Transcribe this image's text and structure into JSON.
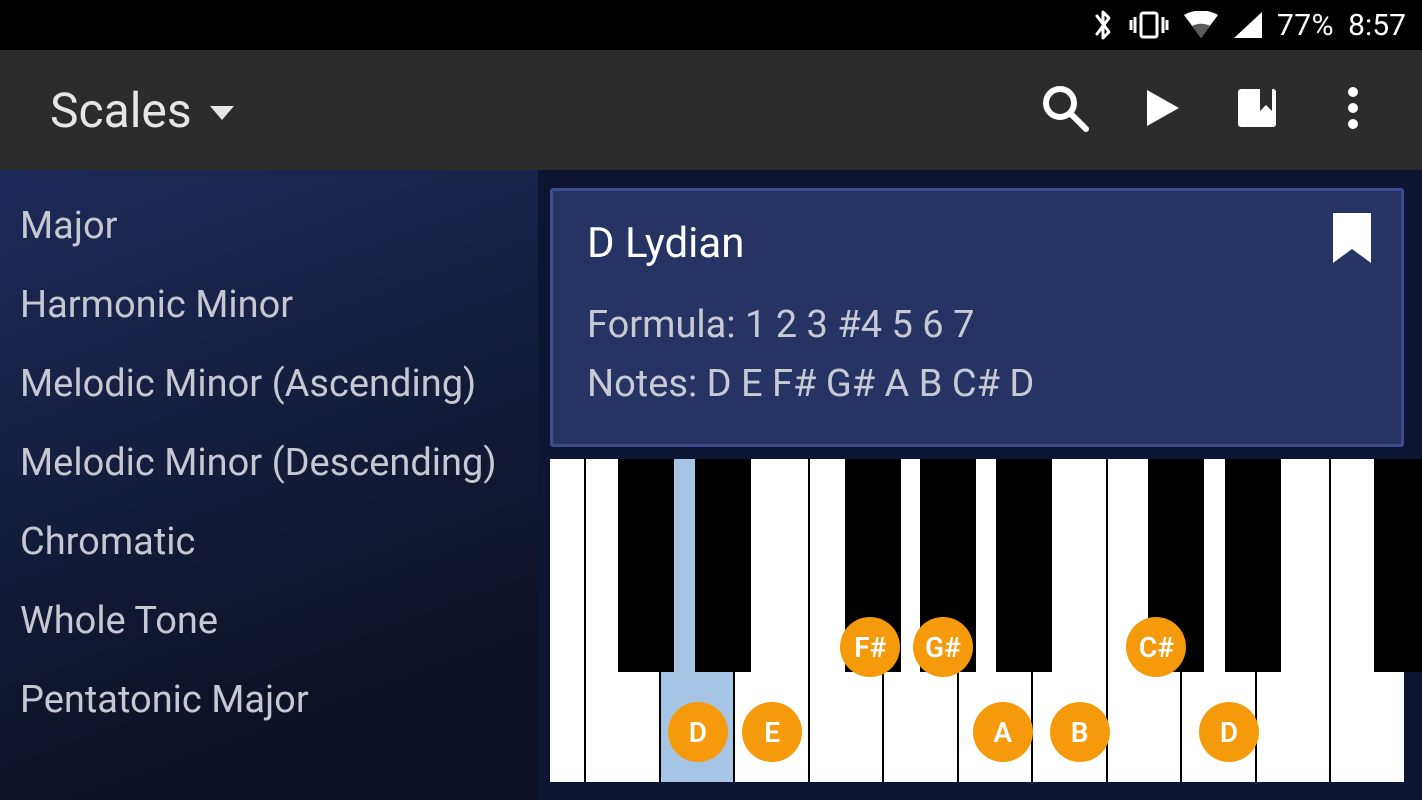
{
  "status": {
    "battery_pct": "77%",
    "time": "8:57",
    "icons": [
      "bluetooth",
      "vibrate",
      "wifi",
      "signal"
    ]
  },
  "appbar": {
    "title": "Scales",
    "actions": {
      "search": "search",
      "play": "play",
      "bookmark": "bookmark",
      "overflow": "more"
    }
  },
  "sidebar": {
    "items": [
      {
        "label": "Major"
      },
      {
        "label": "Harmonic Minor"
      },
      {
        "label": "Melodic Minor (Ascending)"
      },
      {
        "label": "Melodic Minor (Descending)"
      },
      {
        "label": "Chromatic"
      },
      {
        "label": "Whole Tone"
      },
      {
        "label": "Pentatonic Major"
      }
    ]
  },
  "detail": {
    "name": "D Lydian",
    "formula_label": "Formula: 1 2 3 #4 5 6 7",
    "notes_label": "Notes: D E F# G# A B C# D"
  },
  "piano": {
    "highlighted_white_index": 2,
    "markers": [
      {
        "note": "D",
        "type": "white",
        "left_pct": 13.8
      },
      {
        "note": "E",
        "type": "white",
        "left_pct": 22.5
      },
      {
        "note": "F#",
        "type": "black",
        "left_pct": 34.0
      },
      {
        "note": "G#",
        "type": "black",
        "left_pct": 42.5
      },
      {
        "note": "A",
        "type": "white",
        "left_pct": 49.5
      },
      {
        "note": "B",
        "type": "white",
        "left_pct": 58.5
      },
      {
        "note": "C#",
        "type": "black",
        "left_pct": 67.5
      },
      {
        "note": "D",
        "type": "white",
        "left_pct": 76.0
      }
    ],
    "accent_color": "#f59b0b"
  }
}
